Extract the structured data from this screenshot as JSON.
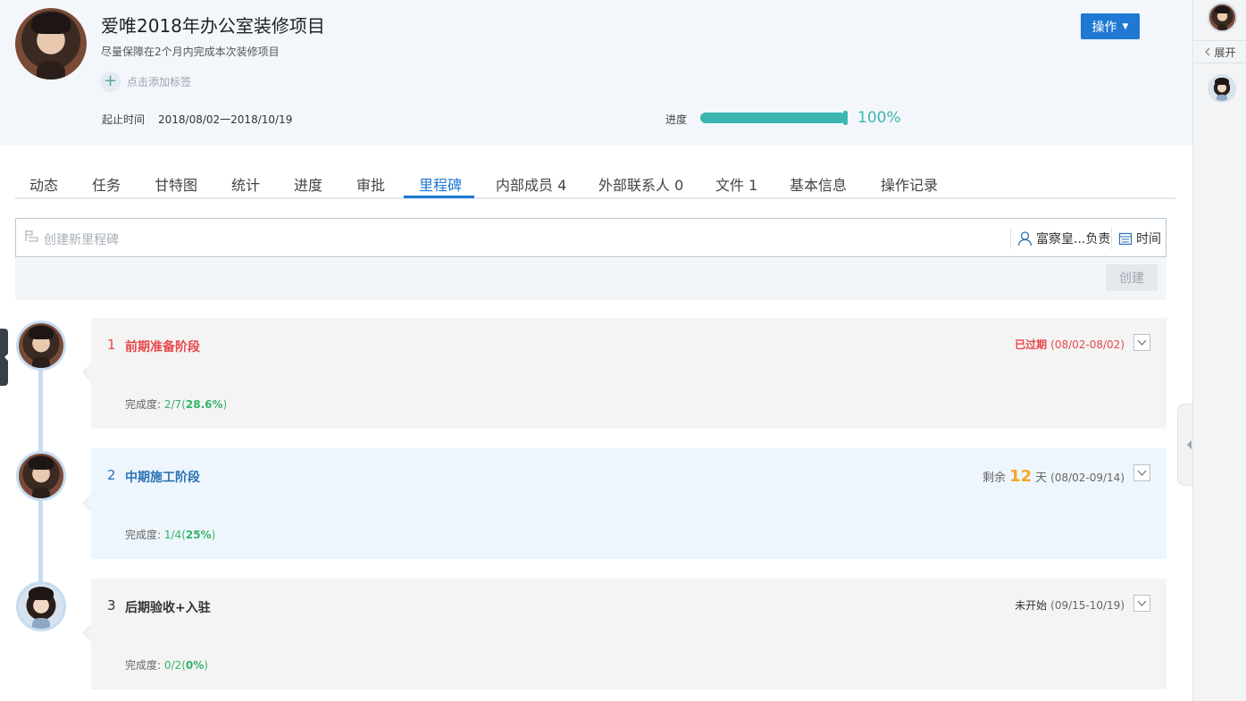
{
  "header": {
    "title": "爱唯2018年办公室装修项目",
    "subtitle": "尽量保障在2个月内完成本次装修项目",
    "add_tag": "点击添加标签",
    "date_label": "起止时间",
    "date_value": "2018/08/02一2018/10/19",
    "progress_label": "进度",
    "progress_value": "100%",
    "progress_fraction": 1.0,
    "progress_color": "#3db6b1",
    "operate_button": "操作"
  },
  "sidebar": {
    "expand_label": "展开"
  },
  "tabs": [
    {
      "label": "动态"
    },
    {
      "label": "任务"
    },
    {
      "label": "甘特图"
    },
    {
      "label": "统计"
    },
    {
      "label": "进度"
    },
    {
      "label": "审批"
    },
    {
      "label": "里程碑",
      "active": true
    },
    {
      "label": "内部成员 4"
    },
    {
      "label": "外部联系人 0"
    },
    {
      "label": "文件 1"
    },
    {
      "label": "基本信息"
    },
    {
      "label": "操作记录"
    }
  ],
  "new_milestone": {
    "placeholder": "创建新里程碑",
    "owner": "富察皇...负责",
    "time": "时间",
    "create_button": "创建"
  },
  "milestones": [
    {
      "index": "1",
      "name": "前期准备阶段",
      "status": "已过期",
      "range": "(08/02-08/02)",
      "done_label": "完成度:",
      "done_frac": "2/7",
      "done_pct": "28.6%"
    },
    {
      "index": "2",
      "name": "中期施工阶段",
      "status_prefix": "剩余",
      "status_days": "12",
      "status_suffix": "天",
      "range": "(08/02-09/14)",
      "done_label": "完成度:",
      "done_frac": "1/4",
      "done_pct": "25%"
    },
    {
      "index": "3",
      "name": "后期验收+入驻",
      "status": "未开始",
      "range": "(09/15-10/19)",
      "done_label": "完成度:",
      "done_frac": "0/2",
      "done_pct": "0%"
    }
  ],
  "colors": {
    "accent": "#1f78d1",
    "overdue": "#e8474a",
    "in_progress": "#2b72b5",
    "days_left": "#f5a623",
    "completion": "#35b36b"
  }
}
